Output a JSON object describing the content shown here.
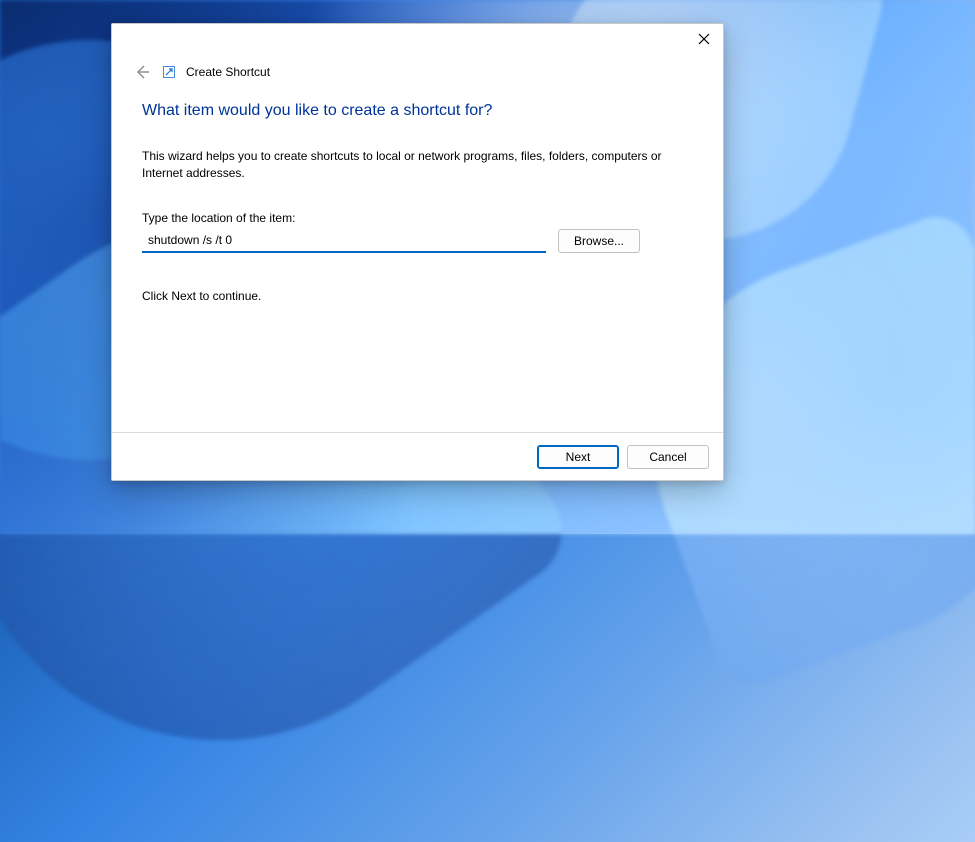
{
  "window": {
    "title": "Create Shortcut"
  },
  "heading": "What item would you like to create a shortcut for?",
  "description": "This wizard helps you to create shortcuts to local or network programs, files, folders, computers or Internet addresses.",
  "field_label": "Type the location of the item:",
  "location_value": "shutdown /s /t 0",
  "browse_label": "Browse...",
  "continue_text": "Click Next to continue.",
  "buttons": {
    "next": "Next",
    "cancel": "Cancel"
  }
}
